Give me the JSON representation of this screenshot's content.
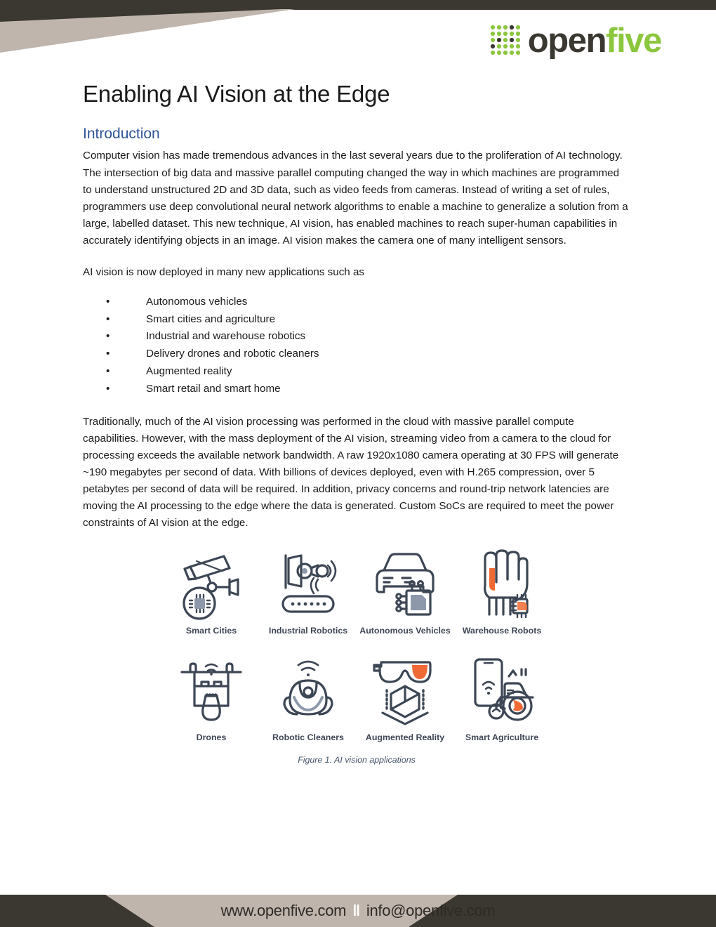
{
  "brand": {
    "logo_word_dark": "open",
    "logo_word_green": "five",
    "dark_color": "#3b3731",
    "tan_color": "#bfb5ad",
    "green_color": "#8cc63e",
    "heading_blue": "#2f5496",
    "icon_slate": "#3d4654",
    "icon_orange": "#f06a35"
  },
  "document": {
    "title": "Enabling AI Vision at the Edge",
    "section_heading": "Introduction",
    "paragraph_1": "Computer vision has made tremendous advances in the last several years due to the proliferation of AI technology. The intersection of big data and massive parallel computing changed the way in which machines are programmed to understand unstructured 2D and 3D data, such as video feeds from cameras. Instead of writing a set of rules, programmers use deep convolutional neural network algorithms to enable a machine to generalize a solution from a large, labelled dataset. This new technique, AI vision, has enabled machines to reach super-human capabilities in accurately identifying objects in an image. AI vision makes the camera one of many intelligent sensors.",
    "paragraph_2": "AI vision is now deployed in many new applications such as",
    "bullet_glyph": "•",
    "bullets": [
      "Autonomous vehicles",
      "Smart cities and agriculture",
      "Industrial and warehouse robotics",
      "Delivery drones and robotic cleaners",
      "Augmented reality",
      "Smart retail and smart home"
    ],
    "paragraph_3": "Traditionally, much of the AI vision processing was performed in the cloud with massive parallel compute capabilities. However, with the mass deployment of the AI vision, streaming video from a camera to the cloud for processing exceeds the available network bandwidth. A raw 1920x1080 camera operating at 30 FPS will generate ~190 megabytes per second of data. With billions of devices deployed, even with H.265 compression, over 5 petabytes per second of data will be required. In addition, privacy concerns and round-trip network latencies are moving the AI processing to the edge where the data is generated. Custom SoCs are required to meet the power constraints of AI vision at the edge."
  },
  "figure": {
    "caption": "Figure 1. AI vision applications",
    "row_1": [
      {
        "label": "Smart Cities",
        "icon": "security-camera-chip-icon"
      },
      {
        "label": "Industrial Robotics",
        "icon": "robotic-arm-icon"
      },
      {
        "label": "Autonomous Vehicles",
        "icon": "car-chip-icon"
      },
      {
        "label": "Warehouse Robots",
        "icon": "robot-hand-icon"
      }
    ],
    "row_2": [
      {
        "label": "Drones",
        "icon": "delivery-drone-icon"
      },
      {
        "label": "Robotic Cleaners",
        "icon": "robot-vacuum-icon"
      },
      {
        "label": "Augmented Reality",
        "icon": "ar-goggles-icon"
      },
      {
        "label": "Smart Agriculture",
        "icon": "tractor-phone-icon"
      }
    ]
  },
  "footer": {
    "website": "www.openfive.com",
    "separator": "‖",
    "email": "info@openfive.com"
  }
}
